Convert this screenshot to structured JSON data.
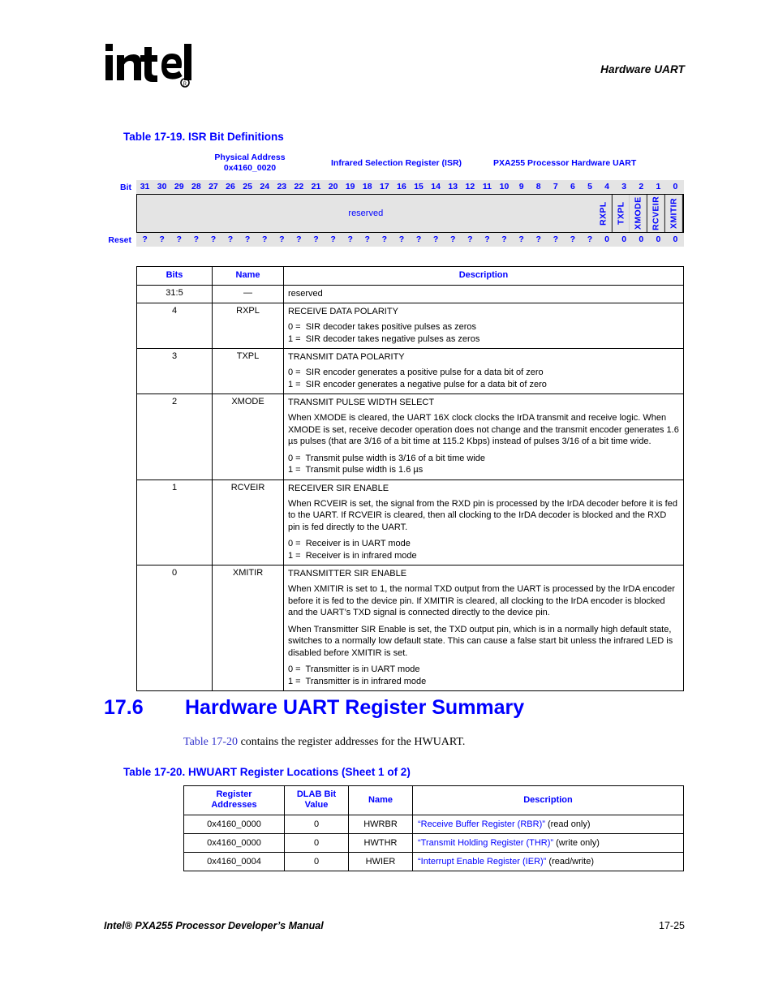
{
  "header": {
    "logo_alt": "intel",
    "chapter_title": "Hardware UART"
  },
  "table_1719": {
    "caption": "Table 17-19. ISR Bit Definitions",
    "register_header": {
      "physical_address_label": "Physical Address",
      "physical_address_value": "0x4160_0020",
      "register_name": "Infrared Selection Register (ISR)",
      "processor_block": "PXA255 Processor Hardware UART"
    },
    "diagram": {
      "bit_label": "Bit",
      "reset_label": "Reset",
      "bit_numbers": [
        "31",
        "30",
        "29",
        "28",
        "27",
        "26",
        "25",
        "24",
        "23",
        "22",
        "21",
        "20",
        "19",
        "18",
        "17",
        "16",
        "15",
        "14",
        "13",
        "12",
        "11",
        "10",
        "9",
        "8",
        "7",
        "6",
        "5",
        "4",
        "3",
        "2",
        "1",
        "0"
      ],
      "reserved_field_label": "reserved",
      "fields": [
        "RXPL",
        "TXPL",
        "XMODE",
        "RCVEIR",
        "XMITIR"
      ],
      "reset_values": [
        "?",
        "?",
        "?",
        "?",
        "?",
        "?",
        "?",
        "?",
        "?",
        "?",
        "?",
        "?",
        "?",
        "?",
        "?",
        "?",
        "?",
        "?",
        "?",
        "?",
        "?",
        "?",
        "?",
        "?",
        "?",
        "?",
        "?",
        "0",
        "0",
        "0",
        "0",
        "0"
      ]
    },
    "columns": [
      "Bits",
      "Name",
      "Description"
    ],
    "rows": [
      {
        "bits": "31:5",
        "name": "—",
        "title": "reserved",
        "paragraphs": [],
        "options": []
      },
      {
        "bits": "4",
        "name": "RXPL",
        "title": "RECEIVE DATA POLARITY",
        "paragraphs": [],
        "options": [
          "0 =  SIR decoder takes positive pulses as zeros",
          "1 =  SIR decoder takes negative pulses as zeros"
        ]
      },
      {
        "bits": "3",
        "name": "TXPL",
        "title": "TRANSMIT DATA POLARITY",
        "paragraphs": [],
        "options": [
          "0 =  SIR encoder generates a positive pulse for a data bit of zero",
          "1 =  SIR encoder generates a negative pulse for a data bit of zero"
        ]
      },
      {
        "bits": "2",
        "name": "XMODE",
        "title": "TRANSMIT PULSE WIDTH SELECT",
        "paragraphs": [
          "When XMODE is cleared, the UART 16X clock clocks the IrDA transmit and receive logic. When XMODE is set, receive decoder operation does not change and the transmit encoder generates 1.6 µs pulses (that are 3/16 of a bit time at 115.2 Kbps) instead of pulses 3/16 of a bit time wide."
        ],
        "options": [
          "0 =  Transmit pulse width is 3/16 of a bit time wide",
          "1 =  Transmit pulse width is 1.6 µs"
        ]
      },
      {
        "bits": "1",
        "name": "RCVEIR",
        "title": "RECEIVER SIR ENABLE",
        "paragraphs": [
          "When RCVEIR is set, the signal from the RXD pin is processed by the IrDA decoder before it is fed to the UART. If RCVEIR is cleared, then all clocking to the IrDA decoder is blocked and the RXD pin is fed directly to the UART."
        ],
        "options": [
          "0 =  Receiver is in UART mode",
          "1 =  Receiver is in infrared mode"
        ]
      },
      {
        "bits": "0",
        "name": "XMITIR",
        "title": "TRANSMITTER SIR ENABLE",
        "paragraphs": [
          "When XMITIR is set to 1, the normal TXD output from the UART is processed by the IrDA encoder before it is fed to the device pin. If XMITIR is cleared, all clocking to the IrDA encoder is blocked and the UART’s TXD signal is connected directly to the device pin.",
          "When Transmitter SIR Enable is set, the TXD output pin, which is in a normally high default state, switches to a normally low default state. This can cause a false start bit unless the infrared LED is disabled before XMITIR is set."
        ],
        "options": [
          "0 =  Transmitter is in UART mode",
          "1 =  Transmitter is in infrared mode"
        ]
      }
    ]
  },
  "section": {
    "number": "17.6",
    "title": "Hardware UART Register Summary",
    "body_xref": "Table 17-20",
    "body_rest": " contains the register addresses for the HWUART."
  },
  "table_1720": {
    "caption": "Table 17-20. HWUART Register Locations (Sheet 1 of 2)",
    "columns": [
      "Register Addresses",
      "DLAB Bit Value",
      "Name",
      "Description"
    ],
    "column_lines": [
      [
        "Register",
        "Addresses"
      ],
      [
        "DLAB Bit",
        "Value"
      ],
      [
        "Name"
      ],
      [
        "Description"
      ]
    ],
    "rows": [
      {
        "address": "0x4160_0000",
        "dlab": "0",
        "name": "HWRBR",
        "desc_link": "“Receive Buffer Register (RBR)”",
        "desc_rest": " (read only)"
      },
      {
        "address": "0x4160_0000",
        "dlab": "0",
        "name": "HWTHR",
        "desc_link": "“Transmit Holding Register (THR)”",
        "desc_rest": " (write only)"
      },
      {
        "address": "0x4160_0004",
        "dlab": "0",
        "name": "HWIER",
        "desc_link": "“Interrupt Enable Register (IER)”",
        "desc_rest": " (read/write)"
      }
    ]
  },
  "footer": {
    "manual_title": "Intel® PXA255 Processor Developer’s Manual",
    "page_number": "17-25"
  },
  "colors": {
    "accent_blue": "#0000FF",
    "diagram_gray": "#E4E4E4",
    "link_blue": "#0000FF"
  }
}
